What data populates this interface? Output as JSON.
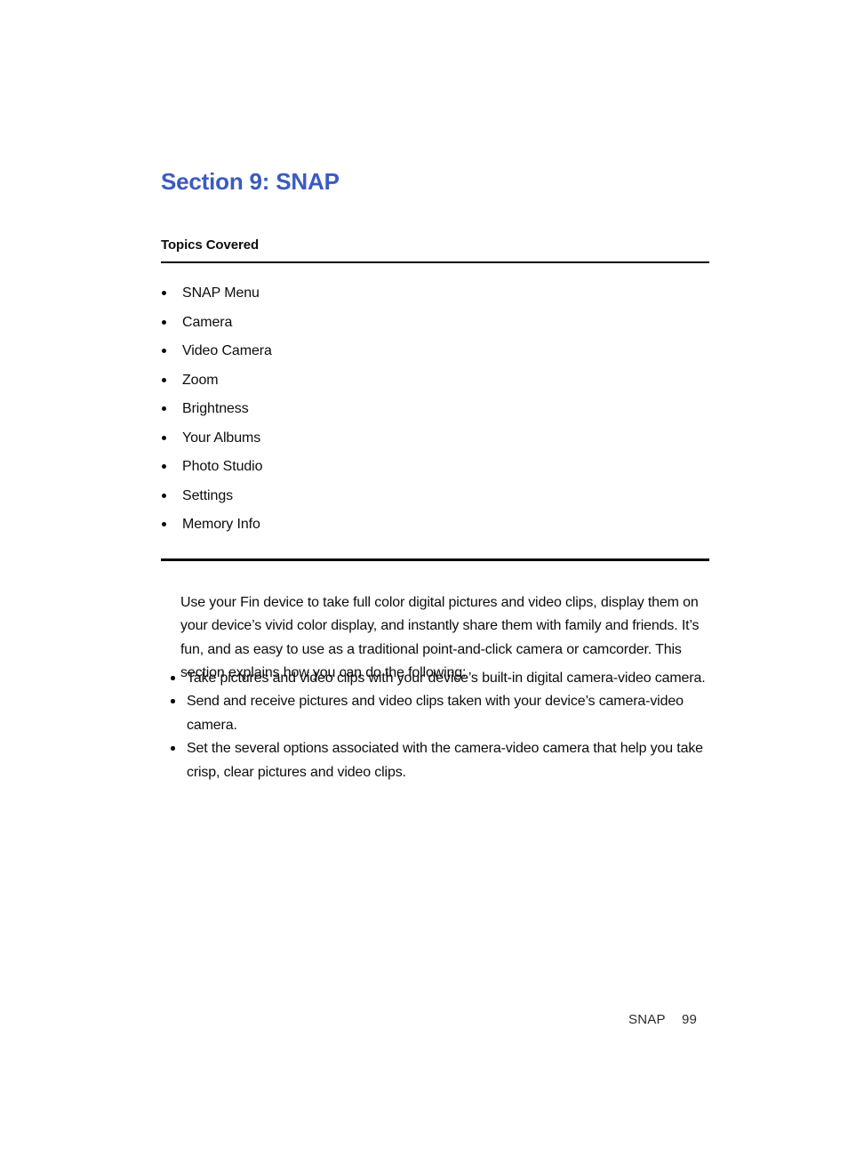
{
  "heading": {
    "title": "Section 9: SNAP",
    "color": "#3b5bc0"
  },
  "topics": {
    "label": "Topics Covered",
    "items": [
      {
        "label": "SNAP Menu"
      },
      {
        "label": "Camera"
      },
      {
        "label": "Video Camera"
      },
      {
        "label": "Zoom"
      },
      {
        "label": "Brightness"
      },
      {
        "label": "Your Albums"
      },
      {
        "label": "Photo Studio"
      },
      {
        "label": "Settings"
      },
      {
        "label": "Memory Info"
      }
    ]
  },
  "body": {
    "intro": "Use your Fin device to take full color digital pictures and video clips, display them on your device’s vivid color display, and instantly share them with family and friends. It’s fun, and as easy to use as a traditional point-and-click camera or camcorder. This section explains how you can do the following:",
    "bullets": [
      {
        "text": "Take pictures and video clips with your device’s built-in digital camera-video camera."
      },
      {
        "text": "Send and receive pictures and video clips taken with your device’s camera-video camera."
      },
      {
        "text": "Set the several options associated with the camera-video camera that help you take crisp, clear pictures and video clips."
      }
    ]
  },
  "footer": {
    "label": "SNAP",
    "page_number": "99"
  }
}
